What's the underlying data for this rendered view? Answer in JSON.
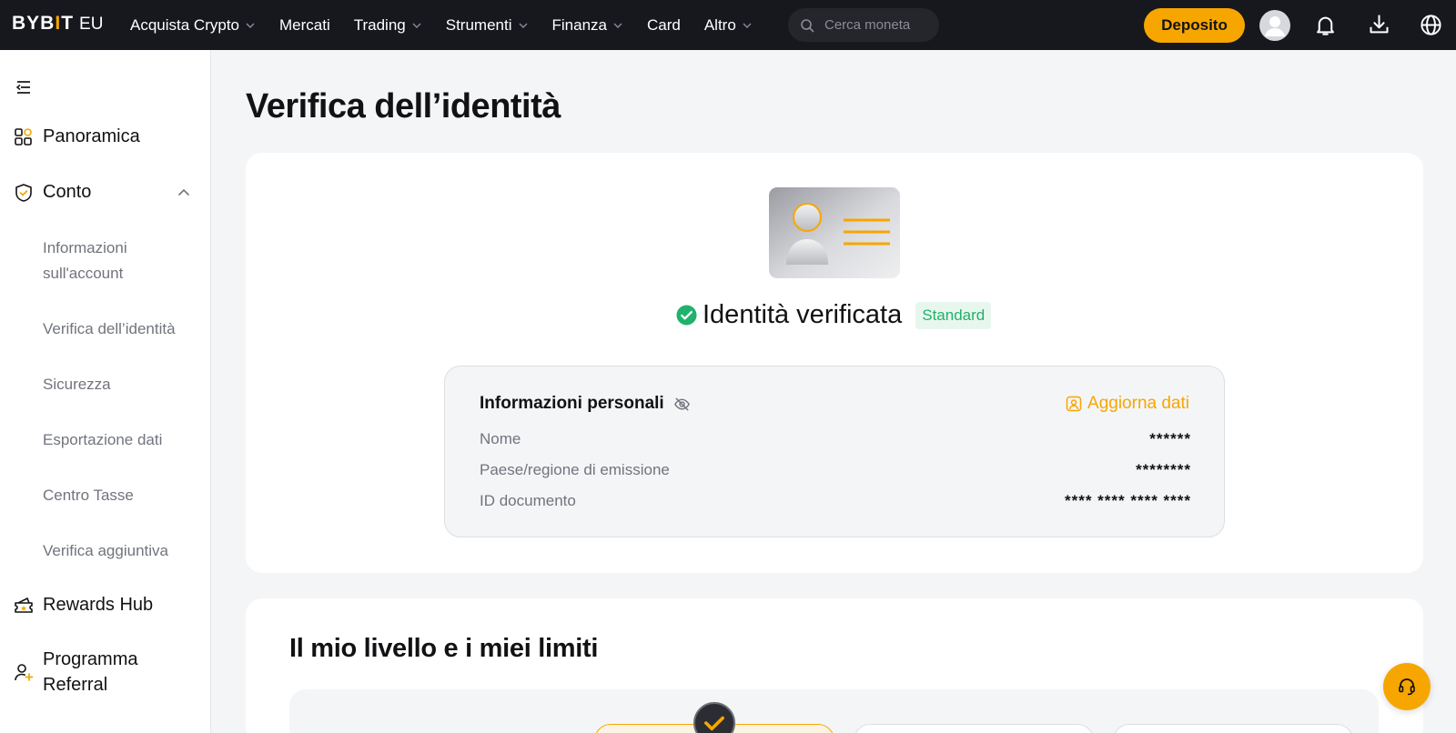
{
  "brand": {
    "name_a": "BYB",
    "name_i": "I",
    "name_b": "T",
    "region": "EU"
  },
  "nav": {
    "items": [
      {
        "label": "Acquista Crypto",
        "has_dropdown": true
      },
      {
        "label": "Mercati",
        "has_dropdown": false
      },
      {
        "label": "Trading",
        "has_dropdown": true
      },
      {
        "label": "Strumenti",
        "has_dropdown": true
      },
      {
        "label": "Finanza",
        "has_dropdown": true
      },
      {
        "label": "Card",
        "has_dropdown": false
      },
      {
        "label": "Altro",
        "has_dropdown": true
      }
    ],
    "search_placeholder": "Cerca moneta",
    "deposit_label": "Deposito",
    "icons": [
      "avatar",
      "bell-icon",
      "download-icon",
      "globe-icon"
    ]
  },
  "sidebar": {
    "main_items": [
      {
        "label": "Panoramica",
        "icon": "dashboard-icon"
      },
      {
        "label": "Conto",
        "icon": "shield-check-icon",
        "expanded": true
      },
      {
        "label": "Rewards Hub",
        "icon": "gift-ticket-icon"
      },
      {
        "label": "Programma Referral",
        "icon": "referral-user-icon"
      }
    ],
    "sub_items": [
      {
        "label": "Informazioni sull'account"
      },
      {
        "label": "Verifica dell’identità"
      },
      {
        "label": "Sicurezza"
      },
      {
        "label": "Esportazione dati"
      },
      {
        "label": "Centro Tasse"
      },
      {
        "label": "Verifica aggiuntiva"
      }
    ]
  },
  "main": {
    "title": "Verifica dell’identità",
    "status_text": "Identità verificata",
    "status_badge": "Standard",
    "personal_info": {
      "title": "Informazioni personali",
      "update_label": "Aggiorna dati",
      "rows": [
        {
          "label": "Nome",
          "value": "******"
        },
        {
          "label": "Paese/regione di emissione",
          "value": "********"
        },
        {
          "label": "ID documento",
          "value": "**** **** **** ****"
        }
      ]
    },
    "limits_title": "Il mio livello e i miei limiti"
  },
  "colors": {
    "accent": "#f7a600",
    "nav_bg": "#17181e",
    "success": "#20b26c",
    "page_bg": "#f4f5f7"
  }
}
